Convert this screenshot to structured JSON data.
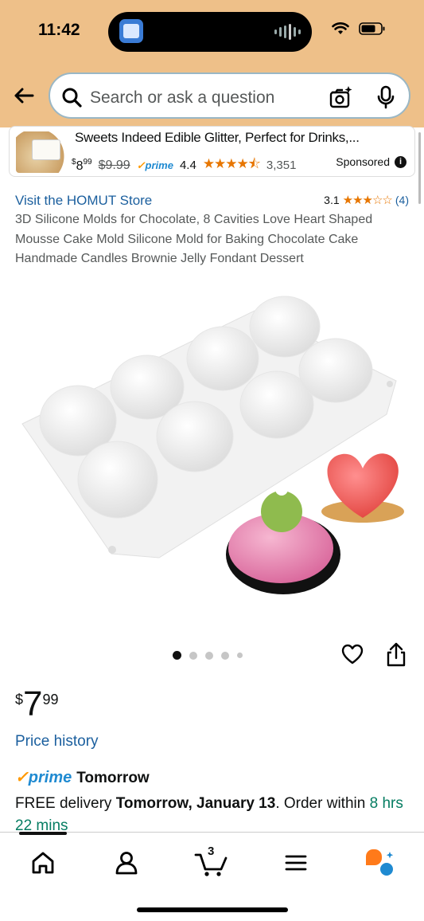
{
  "status_bar": {
    "time": "11:42"
  },
  "search": {
    "placeholder": "Search or ask a question"
  },
  "ad": {
    "title": "Sweets Indeed Edible Glitter, Perfect for Drinks,...",
    "price_sup": "$",
    "price_whole": "8",
    "price_frac": "99",
    "list_price": "$9.99",
    "prime": "prime",
    "rating": "4.4",
    "stars": "★★★★⯪",
    "reviews": "3,351",
    "sponsored": "Sponsored"
  },
  "product": {
    "store_link": "Visit the HOMUT Store",
    "rating": "3.1",
    "stars": "★★★☆☆",
    "review_count": "(4)",
    "title": "3D Silicone Molds for Chocolate, 8 Cavities Love Heart Shaped Mousse Cake Mold Silicone Mold for Baking Chocolate Cake Handmade Candles Brownie Jelly Fondant Dessert",
    "image_count": 5,
    "current_image": 1
  },
  "price": {
    "currency": "$",
    "whole": "7",
    "fraction": "99"
  },
  "price_history": "Price history",
  "delivery": {
    "prime_label": "prime",
    "tomorrow": "Tomorrow",
    "free_prefix": "FREE delivery ",
    "date": "Tomorrow, January 13",
    "order_within": ". Order within ",
    "countdown": "8 hrs 22 mins"
  },
  "nav": {
    "cart_count": "3",
    "items": [
      "home-icon",
      "account-icon",
      "cart-icon",
      "menu-icon",
      "rufus-icon"
    ]
  },
  "colors": {
    "header_bg": "#eec089",
    "link": "#1b5f9e",
    "prime": "#1f8ad1",
    "star": "#e77600",
    "green": "#067d62"
  }
}
